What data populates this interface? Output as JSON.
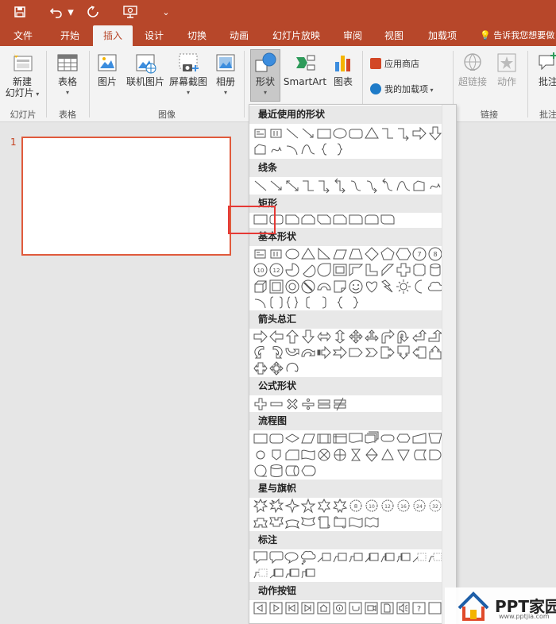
{
  "qat": {
    "save_icon": "save-icon",
    "undo_icon": "undo-icon",
    "redo_icon": "redo-icon",
    "present_icon": "present-from-start-icon",
    "customize_icon": "customize-qat-icon"
  },
  "tabs": [
    {
      "label": "文件"
    },
    {
      "label": "开始"
    },
    {
      "label": "插入"
    },
    {
      "label": "设计"
    },
    {
      "label": "切换"
    },
    {
      "label": "动画"
    },
    {
      "label": "幻灯片放映"
    },
    {
      "label": "审阅"
    },
    {
      "label": "视图"
    },
    {
      "label": "加载项"
    }
  ],
  "tell_me": "告诉我您想要做",
  "ribbon": {
    "new_slide": "新建\n幻灯片",
    "new_slide_l1": "新建",
    "new_slide_l2": "幻灯片",
    "table": "表格",
    "picture": "图片",
    "online_picture": "联机图片",
    "screenshot": "屏幕截图",
    "album": "相册",
    "shapes": "形状",
    "smartart": "SmartArt",
    "chart": "图表",
    "store": "应用商店",
    "my_addins": "我的加载项",
    "hyperlink": "超链接",
    "action": "动作",
    "comment": "批注"
  },
  "groups": {
    "slides": "幻灯片",
    "tables": "表格",
    "images": "图像",
    "links": "链接",
    "comments": "批注"
  },
  "slide_number": "1",
  "gallery": {
    "sections": [
      {
        "title": "最近使用的形状"
      },
      {
        "title": "线条"
      },
      {
        "title": "矩形"
      },
      {
        "title": "基本形状"
      },
      {
        "title": "箭头总汇"
      },
      {
        "title": "公式形状"
      },
      {
        "title": "流程图"
      },
      {
        "title": "星与旗帜"
      },
      {
        "title": "标注"
      },
      {
        "title": "动作按钮"
      }
    ]
  },
  "watermark": {
    "brand": "PPT家园",
    "url": "www.pptjia.com"
  },
  "colors": {
    "accent": "#b7472a",
    "selection": "#e53935",
    "thumb_border": "#e05a3c"
  }
}
